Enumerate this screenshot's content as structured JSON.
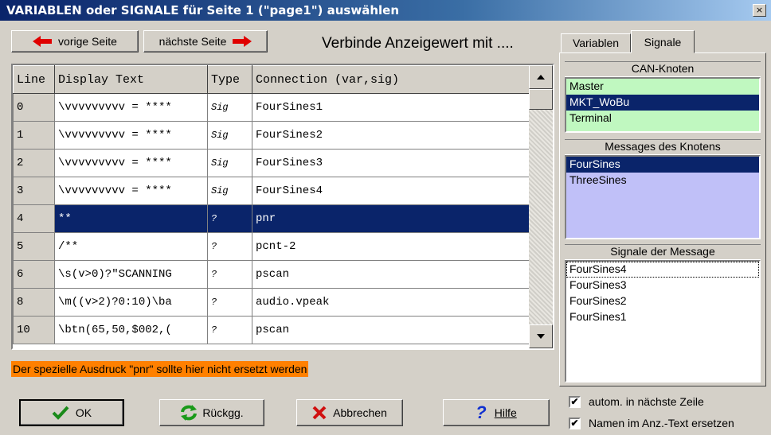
{
  "window": {
    "title": "VARIABLEN oder SIGNALE für Seite 1 (\"page1\") auswählen",
    "close_glyph": "×"
  },
  "nav": {
    "prev_label": "vorige Seite",
    "next_label": "nächste Seite",
    "prev_icon": "arrow-left-icon",
    "next_icon": "arrow-right-icon"
  },
  "headline": "Verbinde Anzeigewert mit ....",
  "grid": {
    "columns": [
      "Line",
      "Display Text",
      "Type",
      "Connection (var,sig)"
    ],
    "rows": [
      {
        "line": "0",
        "text": "\\vvvvvvvvv = ****",
        "type": "Sig",
        "conn": "FourSines1"
      },
      {
        "line": "1",
        "text": "\\vvvvvvvvv = ****",
        "type": "Sig",
        "conn": "FourSines2"
      },
      {
        "line": "2",
        "text": "\\vvvvvvvvv = ****",
        "type": "Sig",
        "conn": "FourSines3"
      },
      {
        "line": "3",
        "text": "\\vvvvvvvvv = ****",
        "type": "Sig",
        "conn": "FourSines4"
      },
      {
        "line": "4",
        "text": "**",
        "type": "?",
        "conn": "pnr"
      },
      {
        "line": "5",
        "text": "/**",
        "type": "?",
        "conn": "pcnt-2"
      },
      {
        "line": "6",
        "text": "\\s(v>0)?\"SCANNING",
        "type": "?",
        "conn": "pscan"
      },
      {
        "line": "8",
        "text": "\\m((v>2)?0:10)\\ba",
        "type": "?",
        "conn": "audio.vpeak"
      },
      {
        "line": "10",
        "text": "\\btn(65,50,$002,(",
        "type": "?",
        "conn": "pscan"
      }
    ],
    "selected_line": "4"
  },
  "tabs": {
    "variables": "Variablen",
    "signals": "Signale",
    "active": "Signale"
  },
  "can_nodes": {
    "label": "CAN-Knoten",
    "items": [
      "Master",
      "MKT_WoBu",
      "Terminal"
    ],
    "selected": "MKT_WoBu"
  },
  "messages": {
    "label": "Messages des Knotens",
    "items": [
      "FourSines",
      "ThreeSines"
    ],
    "selected": "FourSines"
  },
  "signals": {
    "label": "Signale der Message",
    "items": [
      "FourSines4",
      "FourSines3",
      "FourSines2",
      "FourSines1"
    ],
    "focused": "FourSines4"
  },
  "note": "Der spezielle Ausdruck  \"pnr\"  sollte hier nicht ersetzt werden",
  "buttons": {
    "ok": "OK",
    "undo": "Rückgg.",
    "cancel": "Abbrechen",
    "help": "Hilfe"
  },
  "options": {
    "auto_next": {
      "label": "autom. in nächste Zeile",
      "checked": true
    },
    "replace_names": {
      "label": "Namen im Anz.-Text ersetzen",
      "checked": true
    }
  },
  "colors": {
    "selection": "#0a246a",
    "nodes_bg": "#c0f8c0",
    "messages_bg": "#c0c0f8",
    "note_bg": "#ff8000",
    "arrow_red": "#e00000"
  }
}
